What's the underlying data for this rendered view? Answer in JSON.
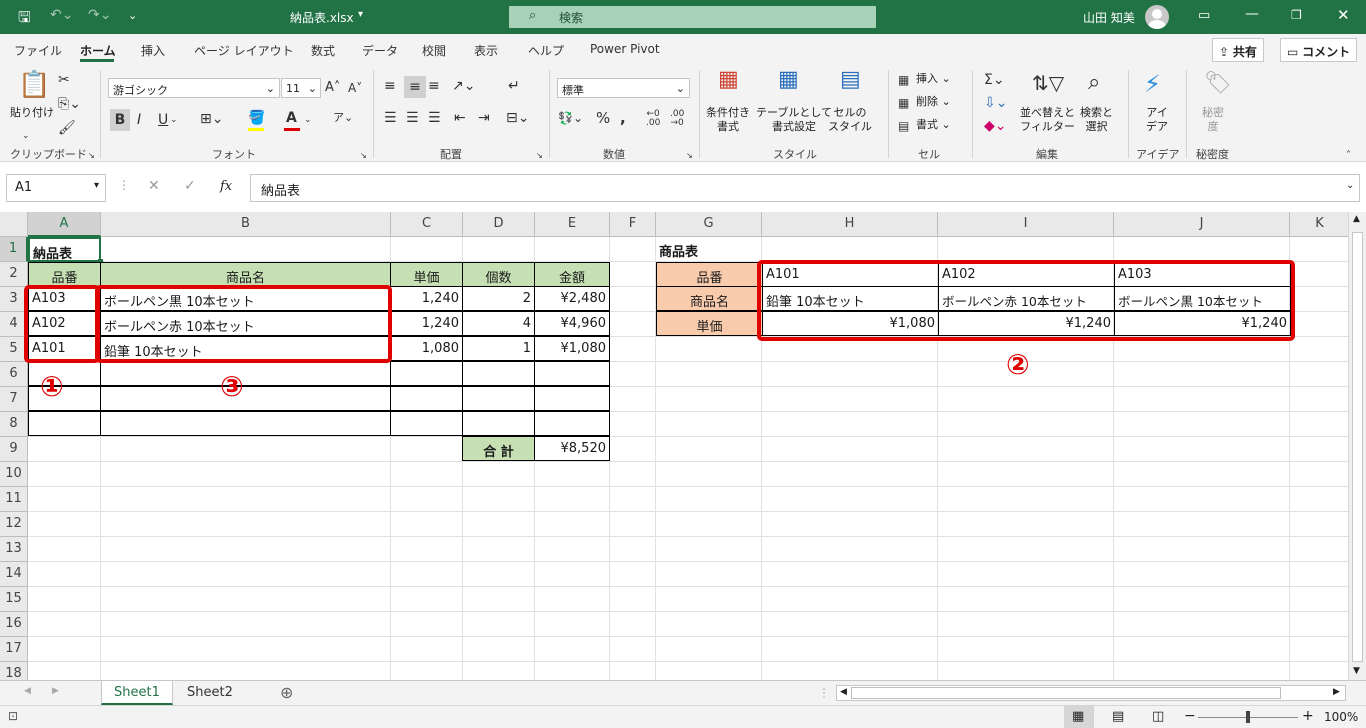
{
  "titlebar": {
    "filename": "納品表.xlsx",
    "search_placeholder": "検索",
    "user_name": "山田 知美"
  },
  "menu": {
    "tabs": [
      "ファイル",
      "ホーム",
      "挿入",
      "ページ レイアウト",
      "数式",
      "データ",
      "校閲",
      "表示",
      "ヘルプ",
      "Power Pivot"
    ],
    "active_tab": "ホーム",
    "share": "共有",
    "comment": "コメント"
  },
  "ribbon": {
    "clipboard": {
      "paste": "貼り付け",
      "label": "クリップボード"
    },
    "font": {
      "name": "游ゴシック",
      "size": "11",
      "label": "フォント",
      "bold": "B",
      "italic": "I",
      "underline": "U"
    },
    "alignment": {
      "label": "配置"
    },
    "number": {
      "format": "標準",
      "label": "数値"
    },
    "styles": {
      "conditional": "条件付き\n書式",
      "table": "テーブルとして\n書式設定",
      "cell": "セルの\nスタイル",
      "label": "スタイル"
    },
    "cells": {
      "insert": "挿入",
      "delete": "削除",
      "format": "書式",
      "label": "セル"
    },
    "editing": {
      "sort": "並べ替えと\nフィルター",
      "find": "検索と\n選択",
      "label": "編集"
    },
    "ideas": {
      "btn": "アイ\nデア",
      "label": "アイデア"
    },
    "sensitivity": {
      "btn": "秘密\n度",
      "label": "秘密度"
    }
  },
  "formula_bar": {
    "name_box": "A1",
    "fx": "fx",
    "content": "納品表"
  },
  "columns": [
    "A",
    "B",
    "C",
    "D",
    "E",
    "F",
    "G",
    "H",
    "I",
    "J",
    "K"
  ],
  "rows": [
    "1",
    "2",
    "3",
    "4",
    "5",
    "6",
    "7",
    "8",
    "9",
    "10",
    "11",
    "12",
    "13",
    "14",
    "15",
    "16",
    "17",
    "18"
  ],
  "invoice": {
    "title": "納品表",
    "headers": [
      "品番",
      "商品名",
      "単価",
      "個数",
      "金額"
    ],
    "items": [
      {
        "code": "A103",
        "name": "ボールペン黒 10本セット",
        "price": "1,240",
        "qty": "2",
        "amount": "¥2,480"
      },
      {
        "code": "A102",
        "name": "ボールペン赤 10本セット",
        "price": "1,240",
        "qty": "4",
        "amount": "¥4,960"
      },
      {
        "code": "A101",
        "name": "鉛筆 10本セット",
        "price": "1,080",
        "qty": "1",
        "amount": "¥1,080"
      }
    ],
    "total_label": "合 計",
    "total": "¥8,520"
  },
  "product_table": {
    "title": "商品表",
    "row_labels": [
      "品番",
      "商品名",
      "単価"
    ],
    "codes": [
      "A101",
      "A102",
      "A103"
    ],
    "names": [
      "鉛筆 10本セット",
      "ボールペン赤 10本セット",
      "ボールペン黒 10本セット"
    ],
    "prices": [
      "¥1,080",
      "¥1,240",
      "¥1,240"
    ]
  },
  "annotations": [
    "①",
    "②",
    "③"
  ],
  "sheet_tabs": [
    "Sheet1",
    "Sheet2"
  ],
  "status": {
    "zoom": "100%"
  },
  "colors": {
    "excel_green": "#217346",
    "header_green": "#c6e0b4",
    "header_orange": "#f8cbad",
    "highlight_red": "#e00000"
  }
}
